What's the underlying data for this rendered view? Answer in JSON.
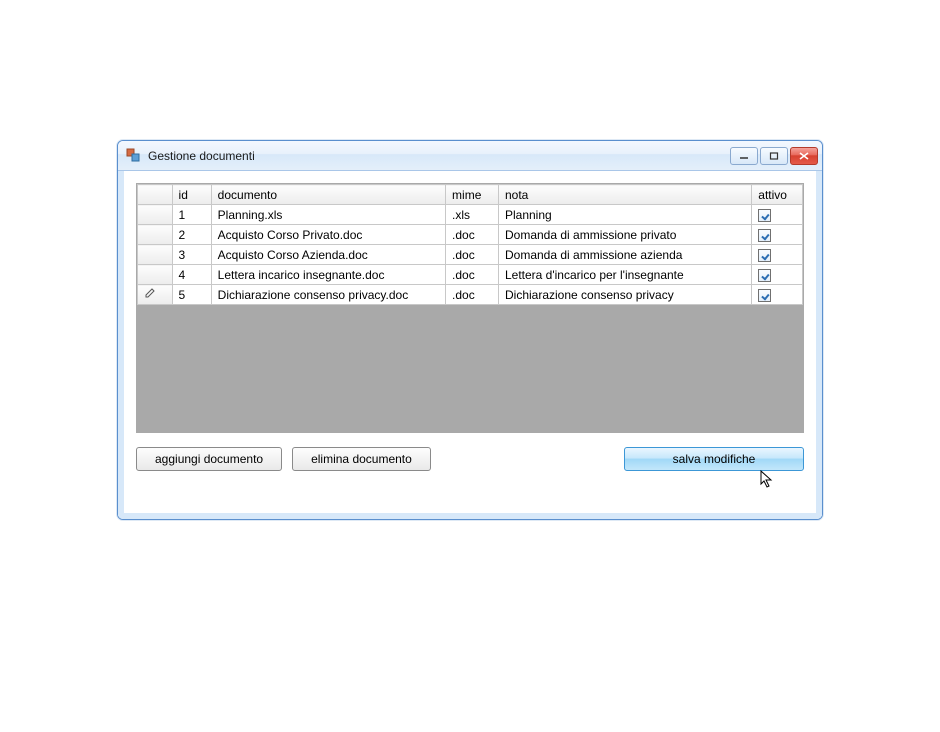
{
  "window": {
    "title": "Gestione documenti"
  },
  "grid": {
    "headers": {
      "id": "id",
      "documento": "documento",
      "mime": "mime",
      "nota": "nota",
      "attivo": "attivo"
    },
    "rows": [
      {
        "editing": false,
        "id": "1",
        "documento": "Planning.xls",
        "mime": ".xls",
        "nota": "Planning",
        "attivo": true
      },
      {
        "editing": false,
        "id": "2",
        "documento": "Acquisto Corso Privato.doc",
        "mime": ".doc",
        "nota": "Domanda di ammissione privato",
        "attivo": true
      },
      {
        "editing": false,
        "id": "3",
        "documento": "Acquisto Corso Azienda.doc",
        "mime": ".doc",
        "nota": "Domanda di ammissione azienda",
        "attivo": true
      },
      {
        "editing": false,
        "id": "4",
        "documento": "Lettera incarico insegnante.doc",
        "mime": ".doc",
        "nota": "Lettera d'incarico per l'insegnante",
        "attivo": true
      },
      {
        "editing": true,
        "id": "5",
        "documento": "Dichiarazione consenso privacy.doc",
        "mime": ".doc",
        "nota": "Dichiarazione consenso privacy",
        "attivo": true
      }
    ]
  },
  "buttons": {
    "add": "aggiungi documento",
    "delete": "elimina documento",
    "save": "salva modifiche"
  }
}
